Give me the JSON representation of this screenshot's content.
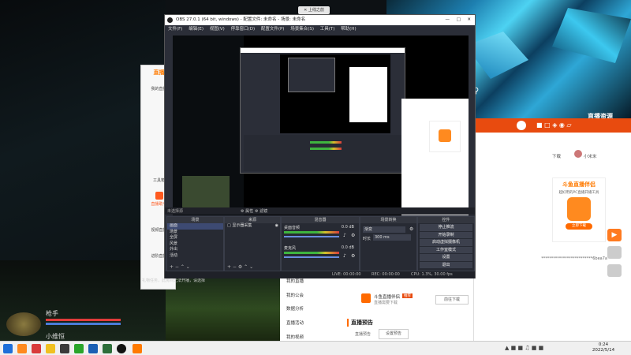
{
  "desktop": {
    "topright_label": "直播资源",
    "tooltip": "✕ 上线之前"
  },
  "douyu_client": {
    "title": "直播",
    "items": [
      "我的直播",
      "工具箱",
      "直播助手",
      "视频直播",
      "进阶直播"
    ],
    "notice": "礼物任务，此房间无法开播，请选择"
  },
  "obs": {
    "title": "OBS 27.0.1 (64 bit, windows) - 配置文件: 未命名 - 场景: 未命名",
    "menu": [
      "文件(F)",
      "编辑(E)",
      "视图(V)",
      "停靠窗口(D)",
      "配置文件(P)",
      "场景集合(S)",
      "工具(T)",
      "帮助(H)"
    ],
    "context_label": "未选择源",
    "props_btn": "属性",
    "filters_btn": "滤镜",
    "docks": {
      "scenes": {
        "title": "场景",
        "items": [
          "画面",
          "场景",
          "全屏",
          "风景",
          "外出",
          "活动"
        ]
      },
      "sources": {
        "title": "来源",
        "items": [
          "显示器采集"
        ]
      },
      "mixer": {
        "title": "混音器",
        "tracks": [
          {
            "name": "桌面音频",
            "db": "0.0 dB"
          },
          {
            "name": "麦克风",
            "db": "0.0 dB"
          }
        ]
      },
      "transitions": {
        "title": "场景转换",
        "mode": "渐变",
        "duration_label": "时长",
        "duration_value": "300 ms"
      },
      "controls": {
        "title": "控件",
        "buttons": [
          "停止推流",
          "开始录制",
          "启动虚拟摄像机",
          "工作室模式",
          "设置",
          "退出"
        ]
      }
    },
    "status": {
      "live": "LIVE: 00:00:00",
      "rec": "REC: 00:00:00",
      "cpu": "CPU: 1.3%, 30.00 fps"
    }
  },
  "browser": {
    "download_label": "下载",
    "username": "小米米",
    "promo_title": "斗鱼直播伴侣",
    "promo_desc": "超好用的PC直播开播工具",
    "promo_btn": "立即下载",
    "masked_text": "**************************6bea7a",
    "menu_items": [
      "我的直播",
      "我的公会",
      "数据分析",
      "直播活动",
      "我的视频"
    ],
    "banner_title": "斗鱼直播伴侣",
    "banner_badge": "推荐",
    "banner_sub": "直播需要下载",
    "banner_btn": "前往下载",
    "section_title": "直播预告",
    "preview_label": "直播预告",
    "preview_btn": "设置预告"
  },
  "game_hud": {
    "player1": "枪手",
    "player2": "小维恒"
  },
  "taskbar": {
    "time": "0:24",
    "date": "2022/5/14"
  },
  "colors": {
    "douyu_orange": "#ff7a00",
    "obs_bg": "#2b2e38",
    "browser_accent": "#e84b0f"
  }
}
